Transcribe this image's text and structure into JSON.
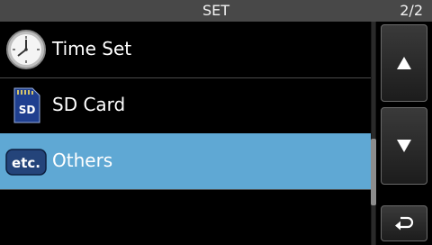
{
  "header": {
    "title": "SET",
    "page_indicator": "2/2"
  },
  "menu": {
    "items": [
      {
        "label": "Time Set",
        "icon": "clock-icon",
        "selected": false
      },
      {
        "label": "SD Card",
        "icon": "sd-card-icon",
        "icon_text": "SD",
        "selected": false
      },
      {
        "label": "Others",
        "icon": "etc-icon",
        "icon_text": "etc.",
        "selected": true
      }
    ]
  },
  "buttons": {
    "scroll_up": "up-arrow-icon",
    "scroll_down": "down-arrow-icon",
    "back": "return-arrow-icon"
  },
  "colors": {
    "selected_row": "#5fa8d4",
    "titlebar": "#484848",
    "background": "#000000"
  }
}
